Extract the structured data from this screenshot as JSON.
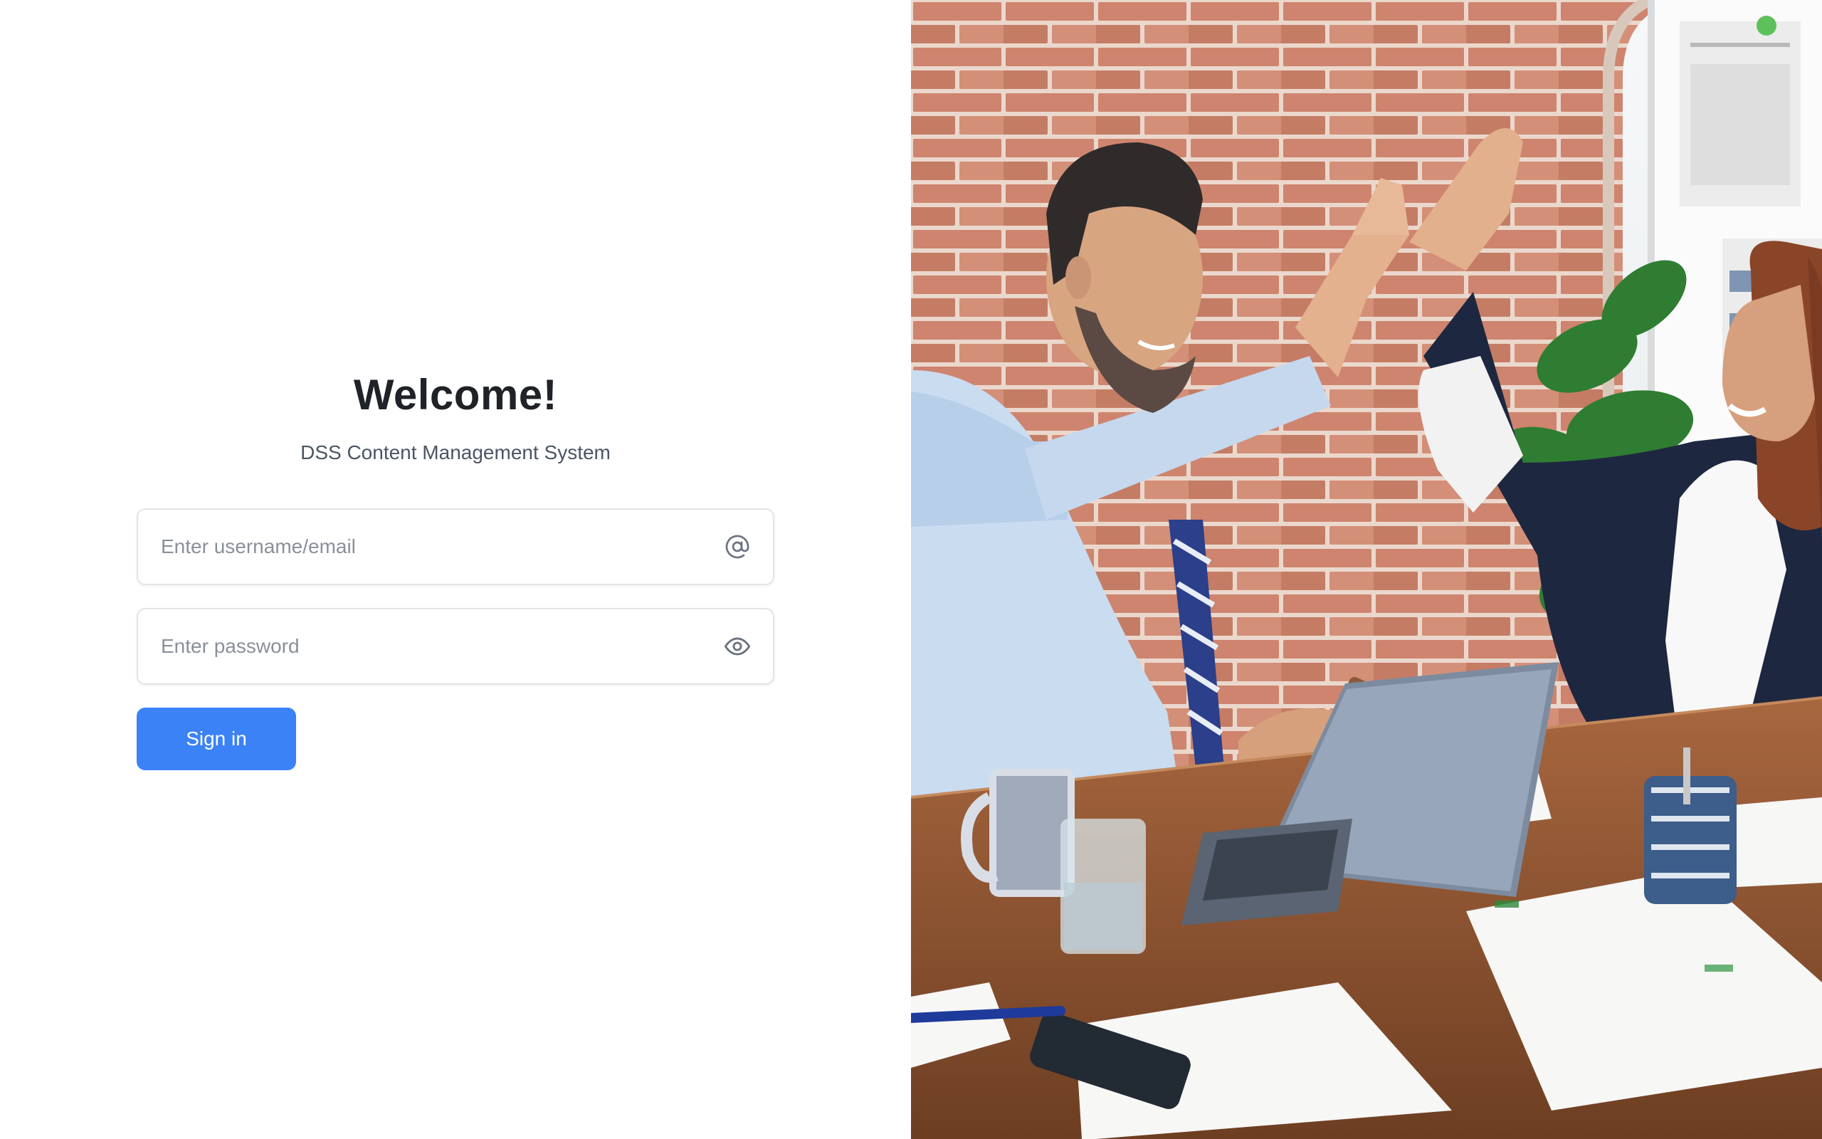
{
  "login": {
    "title": "Welcome!",
    "subtitle": "DSS Content Management System",
    "username_placeholder": "Enter username/email",
    "password_placeholder": "Enter password",
    "signin_label": "Sign in"
  },
  "icons": {
    "username": "at-sign-icon",
    "password": "eye-icon"
  },
  "colors": {
    "accent": "#3b82f6",
    "title": "#1f2328",
    "subtitle": "#4b5563",
    "placeholder": "#8a9099",
    "border": "#e2e4e8"
  }
}
